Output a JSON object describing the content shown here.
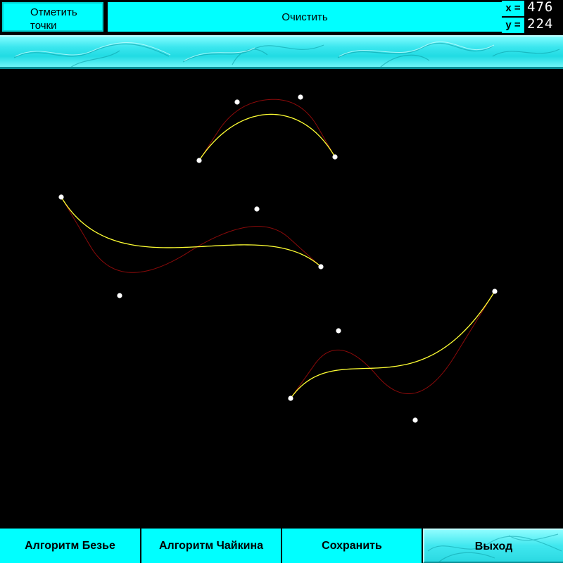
{
  "toolbar": {
    "mark_points_label_line1": "Отметить",
    "mark_points_label_line2": "точки",
    "clear_label": "Очистить"
  },
  "coordinates": {
    "x_label": "x =",
    "x_value": "476",
    "y_label": "y =",
    "y_value": "224"
  },
  "canvas": {
    "counter": "4",
    "colors": {
      "background": "#000000",
      "point": "#ffffff",
      "bezier_curve": "#ffff33",
      "chaikin_curve": "#8b0a0a"
    }
  },
  "bottom_bar": {
    "bezier_label": "Алгоритм Безье",
    "chaikin_label": "Алгоритм Чайкина",
    "save_label": "Сохранить",
    "exit_label": "Выход"
  },
  "theme": {
    "accent": "#00ffff",
    "text": "#000000"
  }
}
